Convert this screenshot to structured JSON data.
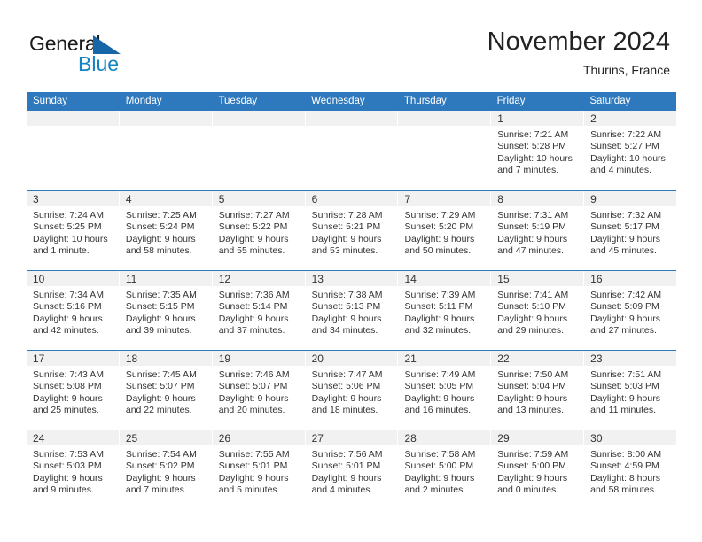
{
  "brand": {
    "line1": "General",
    "line2": "Blue",
    "mark": "blue-triangle-logo"
  },
  "header": {
    "title": "November 2024",
    "subtitle": "Thurins, France"
  },
  "theme": {
    "header_blue": "#2e79bd",
    "brand_blue": "#1283c3",
    "daynum_band": "#f1f1f1",
    "text": "#333333"
  },
  "weekdays": [
    "Sunday",
    "Monday",
    "Tuesday",
    "Wednesday",
    "Thursday",
    "Friday",
    "Saturday"
  ],
  "weeks": [
    [
      {
        "day": "",
        "empty": true
      },
      {
        "day": "",
        "empty": true
      },
      {
        "day": "",
        "empty": true
      },
      {
        "day": "",
        "empty": true
      },
      {
        "day": "",
        "empty": true
      },
      {
        "day": "1",
        "sunrise": "Sunrise: 7:21 AM",
        "sunset": "Sunset: 5:28 PM",
        "daylight": "Daylight: 10 hours and 7 minutes."
      },
      {
        "day": "2",
        "sunrise": "Sunrise: 7:22 AM",
        "sunset": "Sunset: 5:27 PM",
        "daylight": "Daylight: 10 hours and 4 minutes."
      }
    ],
    [
      {
        "day": "3",
        "sunrise": "Sunrise: 7:24 AM",
        "sunset": "Sunset: 5:25 PM",
        "daylight": "Daylight: 10 hours and 1 minute."
      },
      {
        "day": "4",
        "sunrise": "Sunrise: 7:25 AM",
        "sunset": "Sunset: 5:24 PM",
        "daylight": "Daylight: 9 hours and 58 minutes."
      },
      {
        "day": "5",
        "sunrise": "Sunrise: 7:27 AM",
        "sunset": "Sunset: 5:22 PM",
        "daylight": "Daylight: 9 hours and 55 minutes."
      },
      {
        "day": "6",
        "sunrise": "Sunrise: 7:28 AM",
        "sunset": "Sunset: 5:21 PM",
        "daylight": "Daylight: 9 hours and 53 minutes."
      },
      {
        "day": "7",
        "sunrise": "Sunrise: 7:29 AM",
        "sunset": "Sunset: 5:20 PM",
        "daylight": "Daylight: 9 hours and 50 minutes."
      },
      {
        "day": "8",
        "sunrise": "Sunrise: 7:31 AM",
        "sunset": "Sunset: 5:19 PM",
        "daylight": "Daylight: 9 hours and 47 minutes."
      },
      {
        "day": "9",
        "sunrise": "Sunrise: 7:32 AM",
        "sunset": "Sunset: 5:17 PM",
        "daylight": "Daylight: 9 hours and 45 minutes."
      }
    ],
    [
      {
        "day": "10",
        "sunrise": "Sunrise: 7:34 AM",
        "sunset": "Sunset: 5:16 PM",
        "daylight": "Daylight: 9 hours and 42 minutes."
      },
      {
        "day": "11",
        "sunrise": "Sunrise: 7:35 AM",
        "sunset": "Sunset: 5:15 PM",
        "daylight": "Daylight: 9 hours and 39 minutes."
      },
      {
        "day": "12",
        "sunrise": "Sunrise: 7:36 AM",
        "sunset": "Sunset: 5:14 PM",
        "daylight": "Daylight: 9 hours and 37 minutes."
      },
      {
        "day": "13",
        "sunrise": "Sunrise: 7:38 AM",
        "sunset": "Sunset: 5:13 PM",
        "daylight": "Daylight: 9 hours and 34 minutes."
      },
      {
        "day": "14",
        "sunrise": "Sunrise: 7:39 AM",
        "sunset": "Sunset: 5:11 PM",
        "daylight": "Daylight: 9 hours and 32 minutes."
      },
      {
        "day": "15",
        "sunrise": "Sunrise: 7:41 AM",
        "sunset": "Sunset: 5:10 PM",
        "daylight": "Daylight: 9 hours and 29 minutes."
      },
      {
        "day": "16",
        "sunrise": "Sunrise: 7:42 AM",
        "sunset": "Sunset: 5:09 PM",
        "daylight": "Daylight: 9 hours and 27 minutes."
      }
    ],
    [
      {
        "day": "17",
        "sunrise": "Sunrise: 7:43 AM",
        "sunset": "Sunset: 5:08 PM",
        "daylight": "Daylight: 9 hours and 25 minutes."
      },
      {
        "day": "18",
        "sunrise": "Sunrise: 7:45 AM",
        "sunset": "Sunset: 5:07 PM",
        "daylight": "Daylight: 9 hours and 22 minutes."
      },
      {
        "day": "19",
        "sunrise": "Sunrise: 7:46 AM",
        "sunset": "Sunset: 5:07 PM",
        "daylight": "Daylight: 9 hours and 20 minutes."
      },
      {
        "day": "20",
        "sunrise": "Sunrise: 7:47 AM",
        "sunset": "Sunset: 5:06 PM",
        "daylight": "Daylight: 9 hours and 18 minutes."
      },
      {
        "day": "21",
        "sunrise": "Sunrise: 7:49 AM",
        "sunset": "Sunset: 5:05 PM",
        "daylight": "Daylight: 9 hours and 16 minutes."
      },
      {
        "day": "22",
        "sunrise": "Sunrise: 7:50 AM",
        "sunset": "Sunset: 5:04 PM",
        "daylight": "Daylight: 9 hours and 13 minutes."
      },
      {
        "day": "23",
        "sunrise": "Sunrise: 7:51 AM",
        "sunset": "Sunset: 5:03 PM",
        "daylight": "Daylight: 9 hours and 11 minutes."
      }
    ],
    [
      {
        "day": "24",
        "sunrise": "Sunrise: 7:53 AM",
        "sunset": "Sunset: 5:03 PM",
        "daylight": "Daylight: 9 hours and 9 minutes."
      },
      {
        "day": "25",
        "sunrise": "Sunrise: 7:54 AM",
        "sunset": "Sunset: 5:02 PM",
        "daylight": "Daylight: 9 hours and 7 minutes."
      },
      {
        "day": "26",
        "sunrise": "Sunrise: 7:55 AM",
        "sunset": "Sunset: 5:01 PM",
        "daylight": "Daylight: 9 hours and 5 minutes."
      },
      {
        "day": "27",
        "sunrise": "Sunrise: 7:56 AM",
        "sunset": "Sunset: 5:01 PM",
        "daylight": "Daylight: 9 hours and 4 minutes."
      },
      {
        "day": "28",
        "sunrise": "Sunrise: 7:58 AM",
        "sunset": "Sunset: 5:00 PM",
        "daylight": "Daylight: 9 hours and 2 minutes."
      },
      {
        "day": "29",
        "sunrise": "Sunrise: 7:59 AM",
        "sunset": "Sunset: 5:00 PM",
        "daylight": "Daylight: 9 hours and 0 minutes."
      },
      {
        "day": "30",
        "sunrise": "Sunrise: 8:00 AM",
        "sunset": "Sunset: 4:59 PM",
        "daylight": "Daylight: 8 hours and 58 minutes."
      }
    ]
  ]
}
